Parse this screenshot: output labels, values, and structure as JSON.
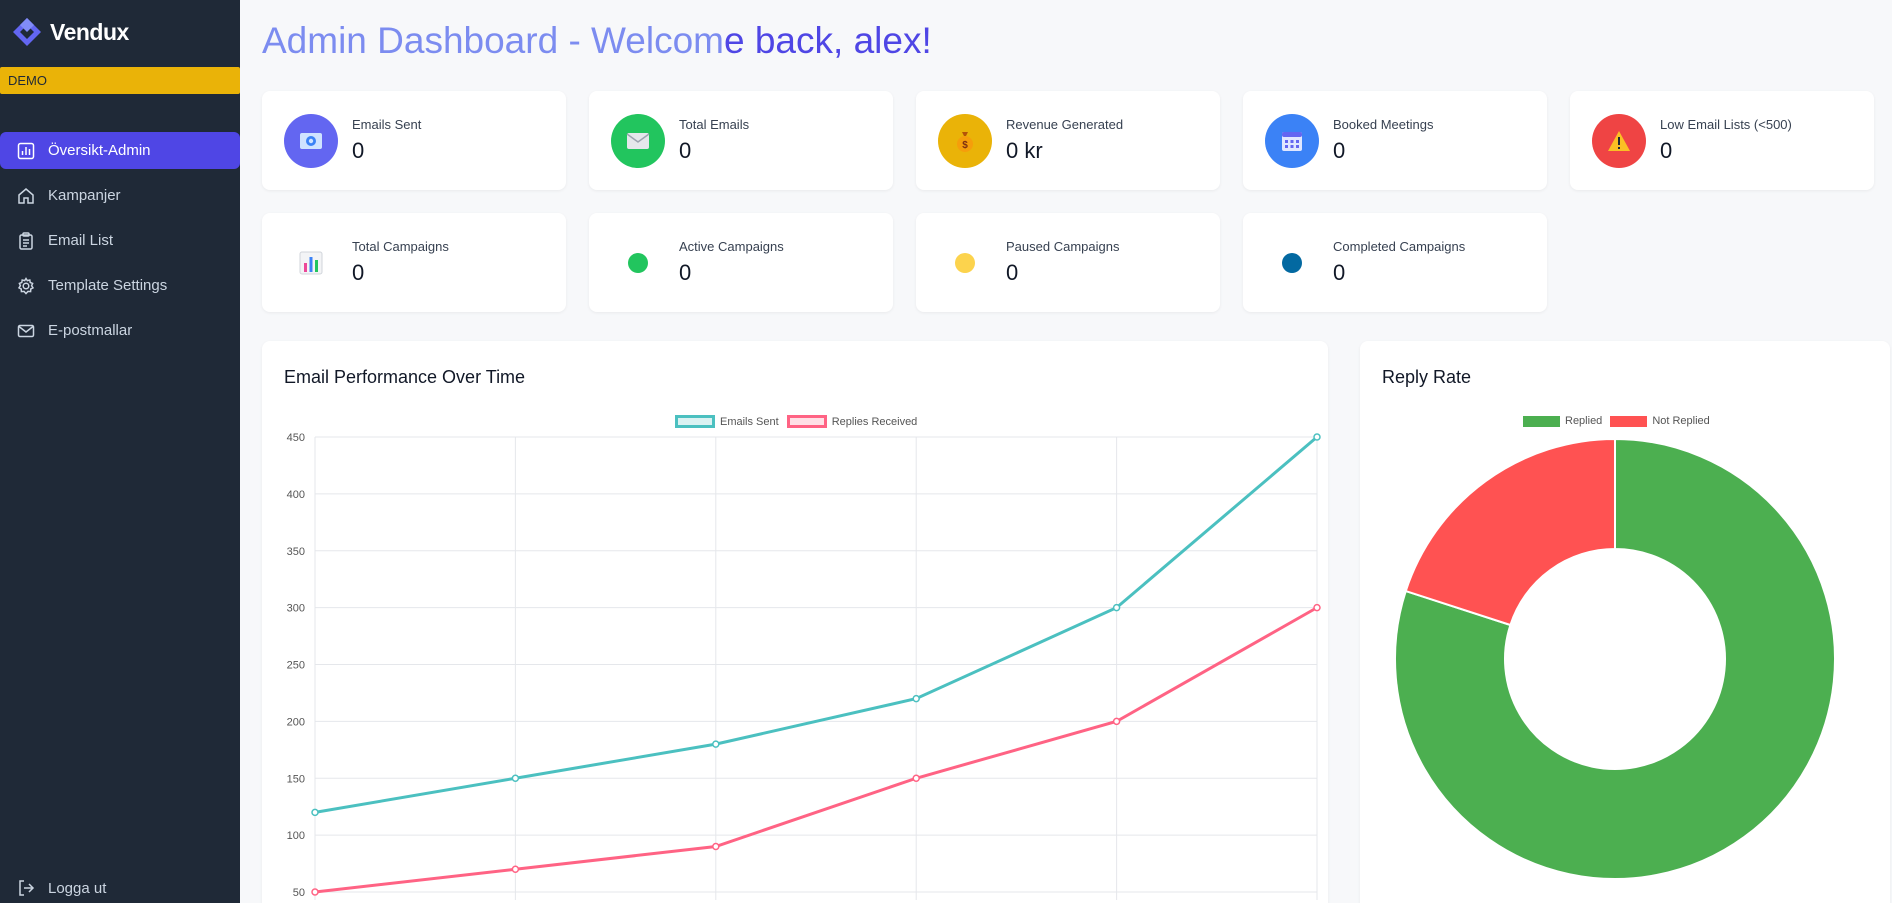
{
  "app": {
    "name": "Vendux",
    "demo_badge": "DEMO"
  },
  "sidebar": {
    "items": [
      {
        "label": "Översikt-Admin",
        "icon": "bar-chart-icon",
        "active": true
      },
      {
        "label": "Kampanjer",
        "icon": "home-icon"
      },
      {
        "label": "Email List",
        "icon": "clipboard-icon"
      },
      {
        "label": "Template Settings",
        "icon": "gear-icon"
      },
      {
        "label": "E-postmallar",
        "icon": "mail-icon"
      }
    ],
    "logout": "Logga ut"
  },
  "header": {
    "title_part1": "Admin Dashboard - Welcom",
    "title_part2": "e back, alex!"
  },
  "stats_row1": [
    {
      "label": "Emails Sent",
      "value": "0",
      "icon": "email-icon",
      "color": "#6366f1"
    },
    {
      "label": "Total Emails",
      "value": "0",
      "icon": "envelope-icon",
      "color": "#22c55e"
    },
    {
      "label": "Revenue Generated",
      "value": "0 kr",
      "icon": "money-bag-icon",
      "color": "#eab308"
    },
    {
      "label": "Booked Meetings",
      "value": "0",
      "icon": "calendar-icon",
      "color": "#3b82f6"
    },
    {
      "label": "Low Email Lists (<500)",
      "value": "0",
      "icon": "warning-icon",
      "color": "#ef4444"
    }
  ],
  "stats_row2": [
    {
      "label": "Total Campaigns",
      "value": "0",
      "icon": "bar-chart-emoji-icon"
    },
    {
      "label": "Active Campaigns",
      "value": "0",
      "icon": "green-circle-icon",
      "color": "#22c55e"
    },
    {
      "label": "Paused Campaigns",
      "value": "0",
      "icon": "yellow-circle-icon",
      "color": "#fcd34d"
    },
    {
      "label": "Completed Campaigns",
      "value": "0",
      "icon": "blue-circle-icon",
      "color": "#0369a1"
    }
  ],
  "line_panel": {
    "title": "Email Performance Over Time"
  },
  "pie_panel": {
    "title": "Reply Rate"
  },
  "chart_data": [
    {
      "type": "line",
      "title": "Email Performance Over Time",
      "x": [
        "",
        "",
        "",
        "",
        "",
        ""
      ],
      "ylim": [
        50,
        450
      ],
      "yticks": [
        50,
        100,
        150,
        200,
        250,
        300,
        350,
        400,
        450
      ],
      "grid": true,
      "legend": "top-center",
      "series": [
        {
          "name": "Emails Sent",
          "values": [
            120,
            150,
            180,
            220,
            300,
            450
          ],
          "color": "#4bc0c0"
        },
        {
          "name": "Replies Received",
          "values": [
            50,
            70,
            90,
            150,
            200,
            300
          ],
          "color": "#ff6384"
        }
      ]
    },
    {
      "type": "pie",
      "title": "Reply Rate",
      "legend": "top-center",
      "labels": [
        "Replied",
        "Not Replied"
      ],
      "values": [
        80,
        20
      ],
      "colors": [
        "#4caf50",
        "#ff5252"
      ]
    }
  ]
}
